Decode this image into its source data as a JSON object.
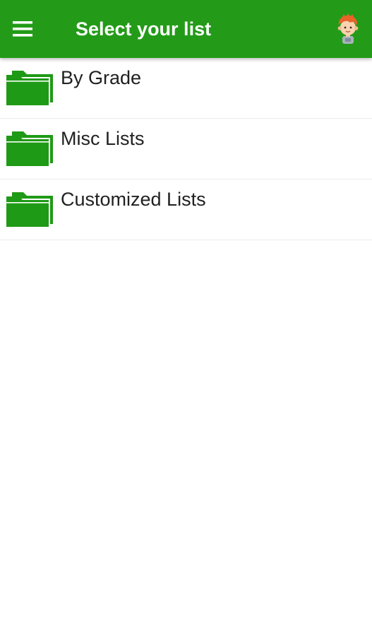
{
  "toolbar": {
    "menu_icon": "hamburger-menu-icon",
    "title": "Select your list",
    "avatar_icon": "cartoon-boy-avatar-icon",
    "background_color": "#239b18"
  },
  "lists": [
    {
      "label": "By Grade",
      "icon": "folder-icon"
    },
    {
      "label": "Misc Lists",
      "icon": "folder-icon"
    },
    {
      "label": "Customized Lists",
      "icon": "folder-icon"
    }
  ],
  "colors": {
    "accent": "#239b18",
    "folder": "#1f9a16",
    "text": "#212121",
    "divider": "#ebebeb"
  }
}
